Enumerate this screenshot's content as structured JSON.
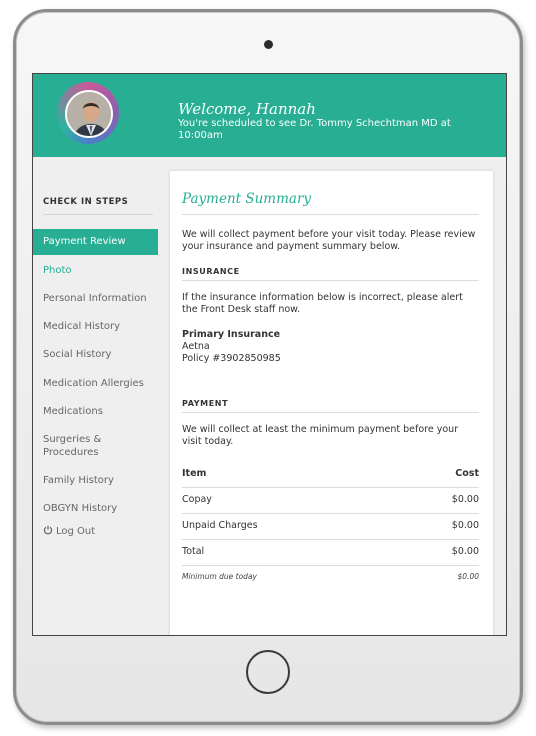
{
  "header": {
    "welcome": "Welcome, Hannah",
    "schedule": "You're scheduled to see Dr. Tommy Schechtman MD at 10:00am"
  },
  "sidebar": {
    "title": "CHECK IN STEPS",
    "items": [
      {
        "label": "Payment Review"
      },
      {
        "label": "Photo"
      },
      {
        "label": "Personal Information"
      },
      {
        "label": "Medical History"
      },
      {
        "label": "Social History"
      },
      {
        "label": "Medication Allergies"
      },
      {
        "label": "Medications"
      },
      {
        "label": "Surgeries & Procedures"
      },
      {
        "label": "Family History"
      },
      {
        "label": "OBGYN History"
      }
    ],
    "logout": "Log Out"
  },
  "main": {
    "title": "Payment Summary",
    "intro": "We will collect payment before your visit today. Please review your insurance and payment summary below.",
    "insurance": {
      "label": "INSURANCE",
      "note": "If the insurance information below is incorrect, please alert the Front Desk staff now.",
      "primary_label": "Primary Insurance",
      "provider": "Aetna",
      "policy": "Policy #3902850985"
    },
    "payment": {
      "label": "PAYMENT",
      "note": "We will collect at least the minimum payment before your visit today.",
      "col_item": "Item",
      "col_cost": "Cost",
      "rows": [
        {
          "item": "Copay",
          "cost": "$0.00"
        },
        {
          "item": "Unpaid Charges",
          "cost": "$0.00"
        },
        {
          "item": "Total",
          "cost": "$0.00"
        }
      ],
      "minimum_label": "Minimum due today",
      "minimum_value": "$0.00"
    }
  },
  "colors": {
    "accent": "#27ae93"
  }
}
